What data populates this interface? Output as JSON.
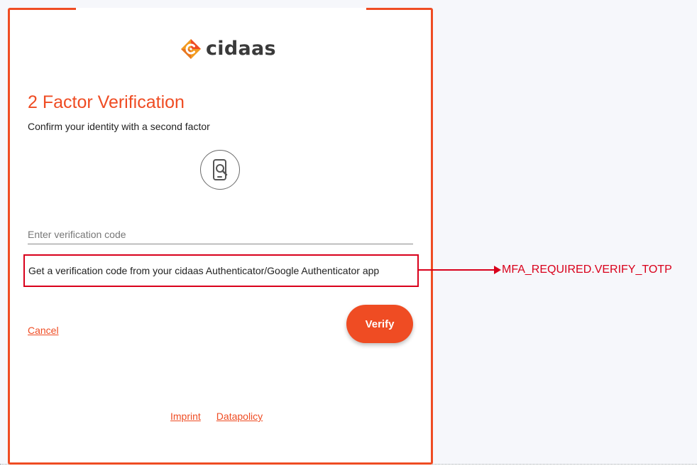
{
  "brand": {
    "logo_text": "cidaas",
    "accent_color": "#ef4c23"
  },
  "page": {
    "title": "2 Factor Verification",
    "subtitle": "Confirm your identity with a second factor",
    "factor_icon": "phone-search-icon"
  },
  "form": {
    "code_placeholder": "Enter verification code",
    "code_value": "",
    "hint": "Get a verification code from your cidaas Authenticator/Google Authenticator app",
    "verify_label": "Verify",
    "cancel_label": "Cancel"
  },
  "annotation": {
    "label": "MFA_REQUIRED.VERIFY_TOTP",
    "color": "#d9001b"
  },
  "footer": {
    "imprint_label": "Imprint",
    "datapolicy_label": "Datapolicy"
  }
}
